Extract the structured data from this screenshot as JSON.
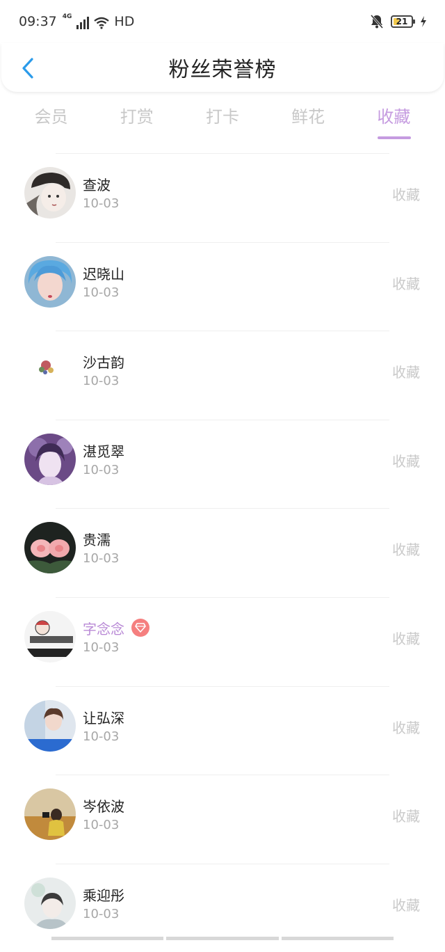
{
  "status_bar": {
    "time": "09:37",
    "network": "4G",
    "hd_label": "HD",
    "battery": "21"
  },
  "header": {
    "title": "粉丝荣誉榜"
  },
  "tabs": [
    {
      "label": "会员"
    },
    {
      "label": "打赏"
    },
    {
      "label": "打卡"
    },
    {
      "label": "鲜花"
    },
    {
      "label": "收藏",
      "active": true
    }
  ],
  "fans": [
    {
      "name": "查波",
      "date": "10-03",
      "action": "收藏"
    },
    {
      "name": "迟晓山",
      "date": "10-03",
      "action": "收藏"
    },
    {
      "name": "沙古韵",
      "date": "10-03",
      "action": "收藏"
    },
    {
      "name": "湛觅翠",
      "date": "10-03",
      "action": "收藏"
    },
    {
      "name": "贵濡",
      "date": "10-03",
      "action": "收藏"
    },
    {
      "name": "字念念",
      "date": "10-03",
      "action": "收藏",
      "vip": true
    },
    {
      "name": "让弘深",
      "date": "10-03",
      "action": "收藏"
    },
    {
      "name": "岑依波",
      "date": "10-03",
      "action": "收藏"
    },
    {
      "name": "乘迎彤",
      "date": "10-03",
      "action": "收藏"
    }
  ],
  "colors": {
    "accent": "#c59be0",
    "back_arrow": "#2b9bea",
    "vip_badge": "#f57f7f"
  }
}
